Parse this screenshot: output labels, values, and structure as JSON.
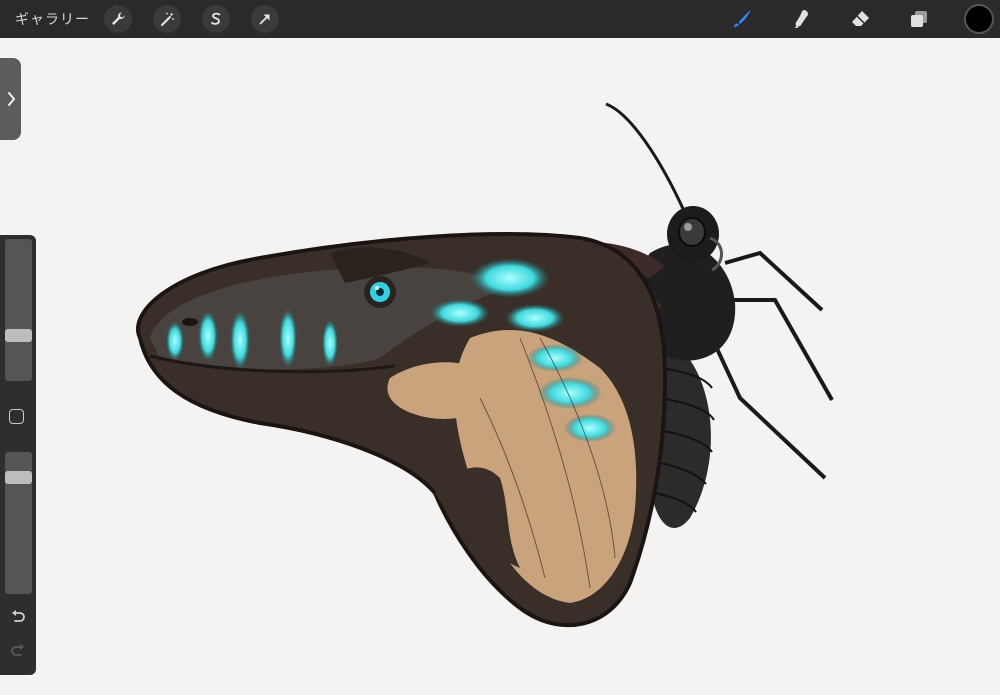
{
  "toolbar": {
    "gallery_label": "ギャラリー",
    "left_tools": [
      {
        "name": "actions-wrench",
        "icon": "wrench-icon"
      },
      {
        "name": "adjustments-wand",
        "icon": "magic-wand-icon"
      },
      {
        "name": "selection",
        "icon": "selection-s-icon"
      },
      {
        "name": "transform",
        "icon": "transform-arrow-icon"
      }
    ],
    "right_tools": [
      {
        "name": "brush",
        "icon": "brush-icon",
        "active": true
      },
      {
        "name": "smudge",
        "icon": "smudge-icon",
        "active": false
      },
      {
        "name": "eraser",
        "icon": "eraser-icon",
        "active": false
      },
      {
        "name": "layers",
        "icon": "layers-icon",
        "active": false
      }
    ],
    "current_color": "#000000",
    "accent_color": "#2f8bff"
  },
  "sidebar": {
    "brush_size_level": 0.3,
    "opacity_level": 0.85
  },
  "artwork": {
    "wing_color": "#3a2f28",
    "wing_tan": "#c9a37c",
    "glow_color": "#4fe8ea",
    "body_color": "#1c1c1c"
  }
}
